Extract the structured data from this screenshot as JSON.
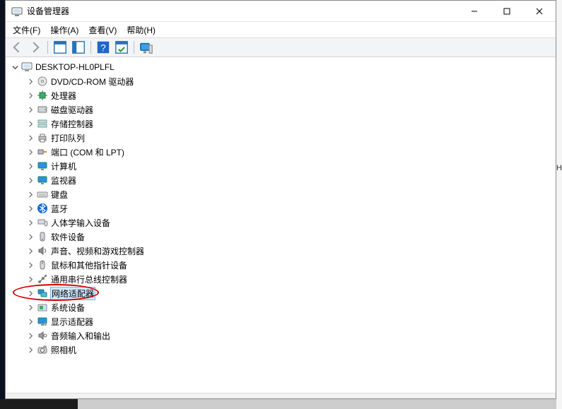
{
  "window": {
    "title": "设备管理器",
    "controls": {
      "minimize": "minimize",
      "maximize": "maximize",
      "close": "close"
    }
  },
  "menu": {
    "file": "文件(F)",
    "action": "操作(A)",
    "view": "查看(V)",
    "help": "帮助(H)"
  },
  "toolbar": {
    "back": "back-icon",
    "forward": "forward-icon",
    "properties": "properties-pane-icon",
    "details": "details-pane-icon",
    "help": "help-icon",
    "scan": "scan-hardware-icon",
    "devices": "devices-icon"
  },
  "tree": {
    "root": {
      "label": "DESKTOP-HL0PLFL",
      "expanded": true
    },
    "children": [
      {
        "id": "dvd",
        "label": "DVD/CD-ROM 驱动器",
        "icon": "disc-icon"
      },
      {
        "id": "cpu",
        "label": "处理器",
        "icon": "chip-icon"
      },
      {
        "id": "disk",
        "label": "磁盘驱动器",
        "icon": "hdd-icon"
      },
      {
        "id": "storage",
        "label": "存储控制器",
        "icon": "storage-controller-icon"
      },
      {
        "id": "print",
        "label": "打印队列",
        "icon": "printer-icon"
      },
      {
        "id": "ports",
        "label": "端口 (COM 和 LPT)",
        "icon": "port-icon"
      },
      {
        "id": "computer",
        "label": "计算机",
        "icon": "monitor-icon"
      },
      {
        "id": "monitor",
        "label": "监视器",
        "icon": "monitor-icon"
      },
      {
        "id": "keyboard",
        "label": "键盘",
        "icon": "keyboard-icon"
      },
      {
        "id": "bluetooth",
        "label": "蓝牙",
        "icon": "bluetooth-icon"
      },
      {
        "id": "hid",
        "label": "人体学输入设备",
        "icon": "hid-icon"
      },
      {
        "id": "software",
        "label": "软件设备",
        "icon": "software-icon"
      },
      {
        "id": "sound",
        "label": "声音、视频和游戏控制器",
        "icon": "speaker-icon"
      },
      {
        "id": "mouse",
        "label": "鼠标和其他指针设备",
        "icon": "mouse-icon"
      },
      {
        "id": "usb",
        "label": "通用串行总线控制器",
        "icon": "usb-icon"
      },
      {
        "id": "network",
        "label": "网络适配器",
        "icon": "network-icon",
        "selected": true,
        "annotated": true
      },
      {
        "id": "system",
        "label": "系统设备",
        "icon": "system-icon"
      },
      {
        "id": "display",
        "label": "显示适配器",
        "icon": "display-adapter-icon"
      },
      {
        "id": "audioio",
        "label": "音频输入和输出",
        "icon": "audio-io-icon"
      },
      {
        "id": "camera",
        "label": "照相机",
        "icon": "camera-icon"
      }
    ]
  },
  "side_letter": "H"
}
